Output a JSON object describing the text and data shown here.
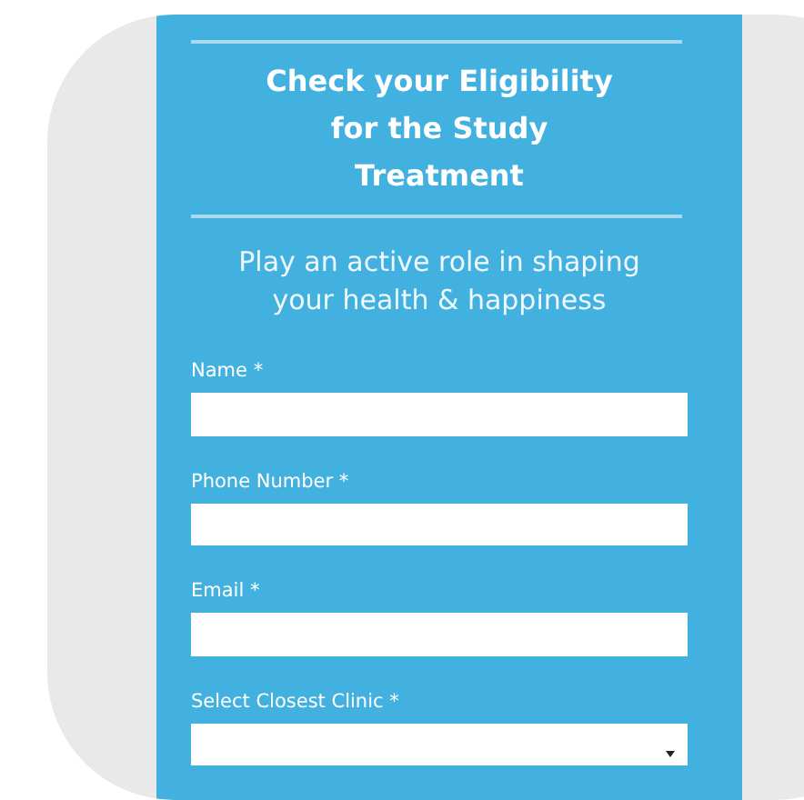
{
  "form": {
    "title": "Check your Eligibility for the Study Treatment",
    "subtitle": "Play an active role in shaping your health & happiness",
    "fields": [
      {
        "label": "Name *",
        "kind": "text"
      },
      {
        "label": "Phone Number *",
        "kind": "text"
      },
      {
        "label": "Email *",
        "kind": "text"
      },
      {
        "label": "Select Closest Clinic *",
        "kind": "select"
      }
    ]
  }
}
